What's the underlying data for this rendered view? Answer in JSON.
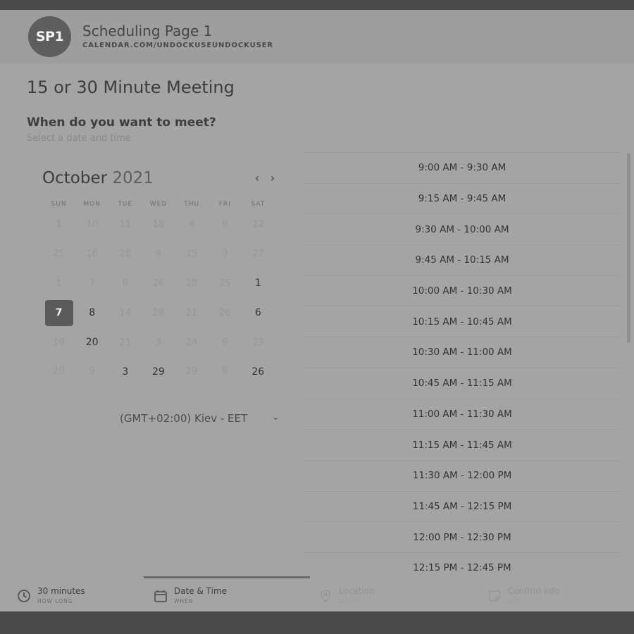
{
  "header": {
    "avatar_initials": "SP1",
    "title": "Scheduling Page 1",
    "url": "CALENDAR.COM/UNDOCKUSEUNDOCKUSER"
  },
  "meeting_title": "15 or 30 Minute Meeting",
  "prompt": {
    "title": "When do you want to meet?",
    "subtitle": "Select a date and time"
  },
  "calendar": {
    "month": "October",
    "year": "2021",
    "prev_icon": "chevron-left-icon",
    "next_icon": "chevron-right-icon",
    "weekdays": [
      "SUN",
      "MON",
      "TUE",
      "WED",
      "THU",
      "FRI",
      "SAT"
    ],
    "days": [
      [
        "1",
        "10",
        "11",
        "18",
        "4",
        "9",
        "22"
      ],
      [
        "25",
        "16",
        "28",
        "9",
        "15",
        "3",
        "27"
      ],
      [
        "1",
        "7",
        "6",
        "26",
        "28",
        "25",
        "1"
      ],
      [
        "7",
        "8",
        "14",
        "28",
        "21",
        "26",
        "6"
      ],
      [
        "19",
        "20",
        "21",
        "3",
        "24",
        "9",
        "23"
      ],
      [
        "20",
        "9",
        "3",
        "29",
        "29",
        "8",
        "26"
      ]
    ],
    "available": [
      [
        false,
        false,
        false,
        false,
        false,
        false,
        false
      ],
      [
        false,
        false,
        false,
        false,
        false,
        false,
        false
      ],
      [
        false,
        false,
        false,
        false,
        false,
        false,
        true
      ],
      [
        true,
        true,
        false,
        false,
        false,
        false,
        true
      ],
      [
        false,
        true,
        false,
        false,
        false,
        false,
        false
      ],
      [
        false,
        false,
        true,
        true,
        false,
        false,
        true
      ]
    ],
    "selected": "7",
    "timezone": "(GMT+02:00) Kiev - EET"
  },
  "slots": [
    "9:00 AM - 9:30 AM",
    "9:15 AM - 9:45 AM",
    "9:30 AM - 10:00 AM",
    "9:45 AM - 10:15 AM",
    "10:00 AM - 10:30 AM",
    "10:15 AM - 10:45 AM",
    "10:30 AM - 11:00 AM",
    "10:45 AM - 11:15 AM",
    "11:00 AM - 11:30 AM",
    "11:15 AM - 11:45 AM",
    "11:30 AM - 12:00 PM",
    "11:45 AM - 12:15 PM",
    "12:00 PM - 12:30 PM",
    "12:15 PM - 12:45 PM"
  ],
  "steps": [
    {
      "label": "30 minutes",
      "sub": "HOW LONG",
      "icon": "clock-icon",
      "active": true
    },
    {
      "label": "Date & Time",
      "sub": "WHEN",
      "icon": "calendar-icon",
      "active": true
    },
    {
      "label": "Location",
      "sub": "WHERE",
      "icon": "location-pin-icon",
      "active": false
    },
    {
      "label": "Confirm Info",
      "sub": "WHO",
      "icon": "document-icon",
      "active": false
    }
  ]
}
